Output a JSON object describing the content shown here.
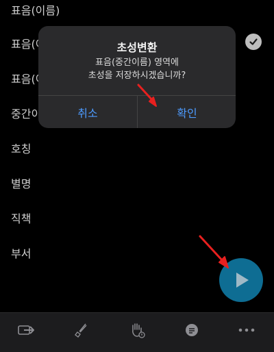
{
  "list": {
    "items": [
      "표음(이름)",
      "표음(이",
      "표음(이",
      "중간이",
      "호칭",
      "별명",
      "직책",
      "부서"
    ]
  },
  "dialog": {
    "title": "초성변환",
    "message_line1": "표음(중간이름) 영역에",
    "message_line2": "초성을 저장하시겠습니까?",
    "cancel_label": "취소",
    "confirm_label": "확인"
  },
  "toolbar": {
    "icons": [
      "share-arrow-icon",
      "brush-icon",
      "hand-icon",
      "comment-icon",
      "more-icon"
    ]
  },
  "colors": {
    "accent": "#4d9bff",
    "fab": "#0e6d93",
    "annotation_arrow": "#e8201f"
  }
}
